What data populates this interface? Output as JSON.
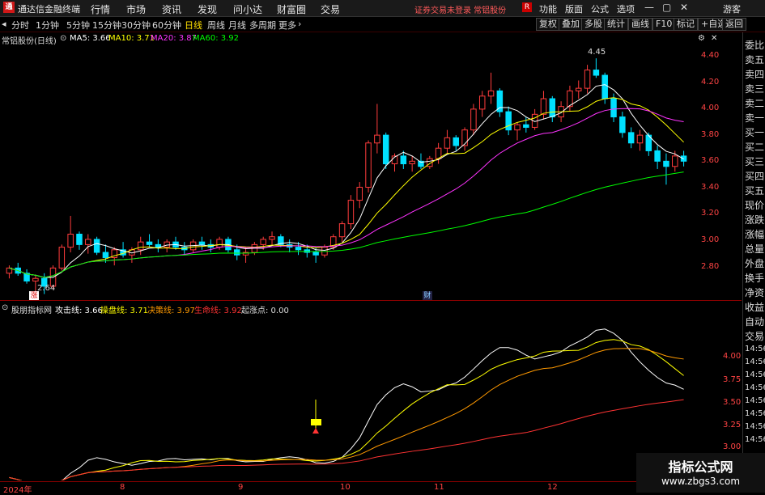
{
  "titlebar": {
    "logo": "通",
    "app_name": "通达信金融终端",
    "menus": [
      "行情",
      "市场",
      "资讯",
      "发现",
      "问小达",
      "财富圈",
      "交易"
    ],
    "warning": "证券交易未登录 常铝股份",
    "right_items": [
      "功能",
      "版面",
      "公式",
      "选项"
    ],
    "user": "游客",
    "logo_r": "R"
  },
  "tabs": {
    "periods": [
      "分时",
      "1分钟",
      "5分钟",
      "15分钟",
      "30分钟",
      "60分钟",
      "日线",
      "周线",
      "月线",
      "多周期",
      "更多"
    ],
    "active": "日线",
    "tools": [
      "复权",
      "叠加",
      "多股",
      "统计",
      "画线",
      "F10",
      "标记",
      "+自选",
      "返回"
    ]
  },
  "main_legend": {
    "stock": "常铝股份(日线)",
    "ma5": "MA5: 3.66",
    "ma10": "MA10: 3.71",
    "ma20": "MA20: 3.87",
    "ma60": "MA60: 3.92",
    "colors": {
      "ma5": "#ffffff",
      "ma10": "#ffff00",
      "ma20": "#ff33ff",
      "ma60": "#00ff00"
    }
  },
  "price_axis": [
    "4.40",
    "4.20",
    "4.00",
    "3.80",
    "3.60",
    "3.40",
    "3.20",
    "3.00",
    "2.80"
  ],
  "annotations": {
    "high": "4.45",
    "low": "2.64",
    "zhang": "涨",
    "cai": "财"
  },
  "ind_legend": {
    "name": "股朋指标网",
    "attack": "攻击线: 3.66",
    "control": "操盘线: 3.71",
    "decision": "决策线: 3.97",
    "life": "生命线: 3.92",
    "start": "起涨点: 0.00"
  },
  "ind_axis": [
    "4.00",
    "3.75",
    "3.50",
    "3.25",
    "3.00"
  ],
  "right_panel": [
    "委比",
    "卖五",
    "卖四",
    "卖三",
    "卖二",
    "卖一",
    "买一",
    "买二",
    "买三",
    "买四",
    "买五",
    "现价",
    "涨跌",
    "涨幅",
    "总量",
    "外盘",
    "换手",
    "净资",
    "收益",
    "自动",
    "交易"
  ],
  "right_times": [
    "14:56",
    "14:56",
    "14:56",
    "14:56",
    "14:56",
    "14:56",
    "14:56",
    "14:56"
  ],
  "date_axis": [
    "2024年",
    "8",
    "9",
    "10",
    "11",
    "12"
  ],
  "watermark": {
    "line1": "指标公式网",
    "line2": "www.zbgs3.com"
  },
  "chart_data": {
    "type": "candlestick",
    "ylim": [
      2.6,
      4.55
    ],
    "candles": [
      [
        2.8,
        2.86,
        2.76,
        2.84
      ],
      [
        2.84,
        2.88,
        2.78,
        2.8
      ],
      [
        2.8,
        2.83,
        2.72,
        2.74
      ],
      [
        2.74,
        2.78,
        2.66,
        2.76
      ],
      [
        2.76,
        2.8,
        2.64,
        2.7
      ],
      [
        2.7,
        2.86,
        2.68,
        2.84
      ],
      [
        2.84,
        3.02,
        2.82,
        3.0
      ],
      [
        3.0,
        3.24,
        2.96,
        3.1
      ],
      [
        3.1,
        3.12,
        2.98,
        3.02
      ],
      [
        3.02,
        3.1,
        2.95,
        3.06
      ],
      [
        3.06,
        3.08,
        2.94,
        2.96
      ],
      [
        2.96,
        3.02,
        2.88,
        2.92
      ],
      [
        2.92,
        3.0,
        2.86,
        2.98
      ],
      [
        2.98,
        3.04,
        2.92,
        2.94
      ],
      [
        2.94,
        3.0,
        2.88,
        2.98
      ],
      [
        2.98,
        3.08,
        2.94,
        3.04
      ],
      [
        3.04,
        3.1,
        3.0,
        3.02
      ],
      [
        3.02,
        3.06,
        2.96,
        3.0
      ],
      [
        3.0,
        3.06,
        2.96,
        3.04
      ],
      [
        3.04,
        3.08,
        2.98,
        3.0
      ],
      [
        3.0,
        3.04,
        2.94,
        2.98
      ],
      [
        2.98,
        3.06,
        2.96,
        3.04
      ],
      [
        3.04,
        3.08,
        2.98,
        3.02
      ],
      [
        3.02,
        3.06,
        2.96,
        3.0
      ],
      [
        3.0,
        3.08,
        2.98,
        3.06
      ],
      [
        3.06,
        3.08,
        2.96,
        2.98
      ],
      [
        2.98,
        3.02,
        2.9,
        2.94
      ],
      [
        2.94,
        3.0,
        2.88,
        2.96
      ],
      [
        2.96,
        3.04,
        2.94,
        3.02
      ],
      [
        3.02,
        3.08,
        2.98,
        3.06
      ],
      [
        3.06,
        3.12,
        3.02,
        3.08
      ],
      [
        3.08,
        3.1,
        3.0,
        3.02
      ],
      [
        3.02,
        3.06,
        2.96,
        3.0
      ],
      [
        3.0,
        3.04,
        2.94,
        2.98
      ],
      [
        2.98,
        3.02,
        2.92,
        2.96
      ],
      [
        2.96,
        3.0,
        2.88,
        2.94
      ],
      [
        2.94,
        3.02,
        2.92,
        3.0
      ],
      [
        3.0,
        3.1,
        2.98,
        3.08
      ],
      [
        3.08,
        3.2,
        3.04,
        3.18
      ],
      [
        3.18,
        3.4,
        3.14,
        3.36
      ],
      [
        3.36,
        3.5,
        3.3,
        3.46
      ],
      [
        3.46,
        3.82,
        3.42,
        3.8
      ],
      [
        3.8,
        4.1,
        3.72,
        3.86
      ],
      [
        3.86,
        3.88,
        3.6,
        3.64
      ],
      [
        3.64,
        3.72,
        3.58,
        3.7
      ],
      [
        3.7,
        3.74,
        3.6,
        3.64
      ],
      [
        3.64,
        3.7,
        3.58,
        3.66
      ],
      [
        3.66,
        3.72,
        3.6,
        3.62
      ],
      [
        3.62,
        3.7,
        3.6,
        3.68
      ],
      [
        3.68,
        3.8,
        3.64,
        3.76
      ],
      [
        3.76,
        3.9,
        3.72,
        3.84
      ],
      [
        3.84,
        3.86,
        3.74,
        3.78
      ],
      [
        3.78,
        3.92,
        3.74,
        3.9
      ],
      [
        3.9,
        4.1,
        3.86,
        4.06
      ],
      [
        4.06,
        4.2,
        4.0,
        4.16
      ],
      [
        4.16,
        4.34,
        4.1,
        4.2
      ],
      [
        4.2,
        4.22,
        4.0,
        4.04
      ],
      [
        4.04,
        4.08,
        3.86,
        3.9
      ],
      [
        3.9,
        3.96,
        3.82,
        3.94
      ],
      [
        3.94,
        4.0,
        3.88,
        3.92
      ],
      [
        3.92,
        4.06,
        3.9,
        4.02
      ],
      [
        4.02,
        4.2,
        3.98,
        4.14
      ],
      [
        4.14,
        4.16,
        3.96,
        4.0
      ],
      [
        4.0,
        4.12,
        3.96,
        4.08
      ],
      [
        4.08,
        4.24,
        4.04,
        4.2
      ],
      [
        4.2,
        4.28,
        4.14,
        4.22
      ],
      [
        4.22,
        4.4,
        4.18,
        4.36
      ],
      [
        4.36,
        4.45,
        4.3,
        4.32
      ],
      [
        4.32,
        4.34,
        4.1,
        4.14
      ],
      [
        4.14,
        4.18,
        3.96,
        4.0
      ],
      [
        4.0,
        4.04,
        3.84,
        3.88
      ],
      [
        3.88,
        3.92,
        3.76,
        3.8
      ],
      [
        3.8,
        3.9,
        3.74,
        3.86
      ],
      [
        3.86,
        3.88,
        3.7,
        3.74
      ],
      [
        3.74,
        3.78,
        3.6,
        3.66
      ],
      [
        3.66,
        3.72,
        3.48,
        3.62
      ],
      [
        3.62,
        3.74,
        3.58,
        3.7
      ],
      [
        3.7,
        3.74,
        3.62,
        3.66
      ]
    ],
    "ma60_color": "#00ff00"
  }
}
